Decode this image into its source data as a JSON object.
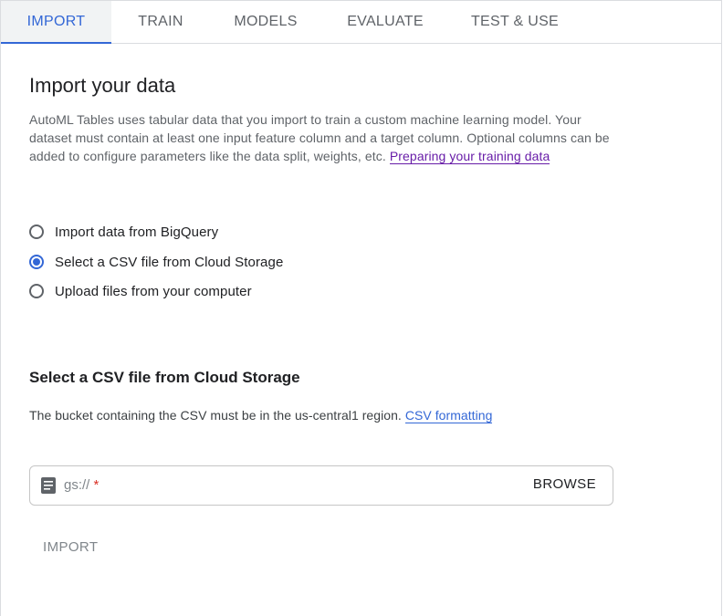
{
  "tabs": [
    {
      "label": "IMPORT",
      "active": true
    },
    {
      "label": "TRAIN",
      "active": false
    },
    {
      "label": "MODELS",
      "active": false
    },
    {
      "label": "EVALUATE",
      "active": false
    },
    {
      "label": "TEST & USE",
      "active": false
    }
  ],
  "import": {
    "title": "Import your data",
    "intro_text": "AutoML Tables uses tabular data that you import to train a custom machine learning model. Your dataset must contain at least one input feature column and a target column. Optional columns can be added to configure parameters like the data split, weights, etc. ",
    "intro_link": "Preparing your training data"
  },
  "source_options": [
    {
      "label": "Import data from BigQuery",
      "selected": false
    },
    {
      "label": "Select a CSV file from Cloud Storage",
      "selected": true
    },
    {
      "label": "Upload files from your computer",
      "selected": false
    }
  ],
  "csv_section": {
    "title": "Select a CSV file from Cloud Storage",
    "note": "The bucket containing the CSV must be in the us-central1 region. ",
    "note_link": "CSV formatting",
    "field_placeholder": "gs://",
    "field_required_mark": "*",
    "field_value": "",
    "field_icon": "file-icon",
    "browse_label": "BROWSE"
  },
  "actions": {
    "import_label": "IMPORT",
    "import_enabled": false
  },
  "colors": {
    "accent": "#3367d6",
    "link_visited": "#681da8",
    "required": "#d93025"
  }
}
